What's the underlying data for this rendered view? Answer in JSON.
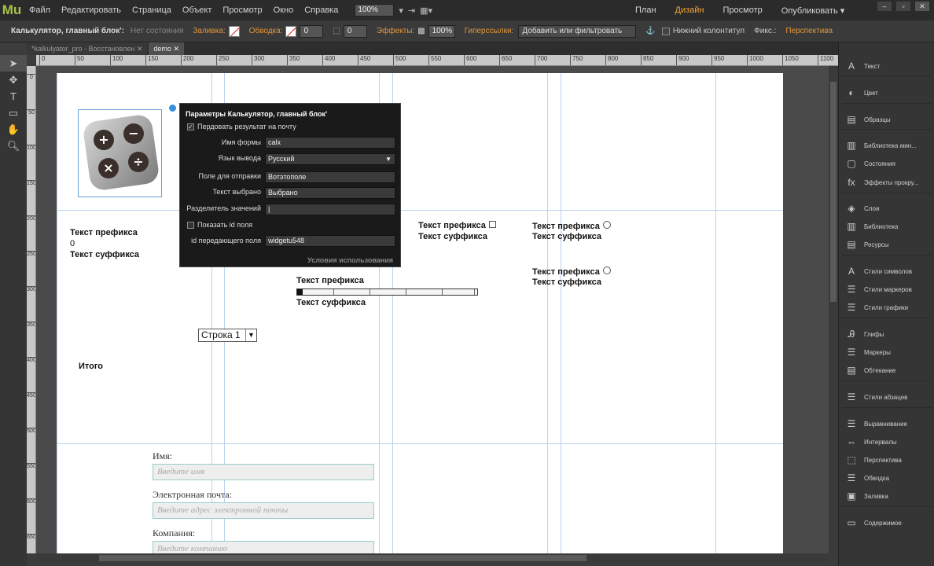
{
  "menubar": {
    "logo": "Mu",
    "items": [
      "Файл",
      "Редактировать",
      "Страница",
      "Объект",
      "Просмотр",
      "Окно",
      "Справка"
    ],
    "zoom": "100%",
    "modes": [
      "План",
      "Дизайн",
      "Просмотр",
      "Опубликовать ▾"
    ],
    "active_mode": "Дизайн"
  },
  "controlbar": {
    "title": "Калькулятор, главный блок':",
    "state": "Нет состояния",
    "fill_label": "Заливка:",
    "stroke_label": "Обводка:",
    "stroke_value": "0",
    "spacing_value": "0",
    "effects_label": "Эффекты:",
    "opacity": "100%",
    "hyperlinks_label": "Гиперссылки:",
    "hyperlink_placeholder": "Добавить или фильтровать",
    "footer_label": "Нижний колонтитул",
    "fix_label": "Фикс.:",
    "perspective_label": "Перспектива"
  },
  "tabs": [
    {
      "label": "*kalkulyator_pro - Восстановлен",
      "active": false
    },
    {
      "label": "demo",
      "active": true
    }
  ],
  "ruler_h": [
    "0",
    "50",
    "100",
    "150",
    "200",
    "250",
    "300",
    "350",
    "400",
    "450",
    "500",
    "550",
    "600",
    "650",
    "700",
    "750",
    "800",
    "850",
    "900",
    "950",
    "1000",
    "1050",
    "1100",
    "1150"
  ],
  "ruler_v": [
    "0",
    "50",
    "100",
    "150",
    "200",
    "250",
    "300",
    "350",
    "400",
    "450",
    "500",
    "550",
    "600",
    "650"
  ],
  "tools": [
    "selection-tool",
    "crop-tool",
    "text-tool",
    "rectangle-tool",
    "hand-tool",
    "zoom-tool"
  ],
  "page": {
    "block1_prefix": "Текст префикса",
    "block1_value": "0",
    "block1_suffix": "Текст суффикса",
    "block2_prefix": "Текст префикса",
    "block2_suffix": "Текст суффикса",
    "block3_prefix": "Текст префикса",
    "block3_suffix": "Текст суффикса",
    "block4_prefix": "Текст префикса",
    "block4_suffix": "Текст суффикса",
    "slider_prefix": "Текст префикса",
    "slider_suffix": "Текст суффикса",
    "select_value": "Строка 1",
    "total_label": "Итого",
    "form_name_label": "Имя:",
    "form_name_placeholder": "Введите имя",
    "form_email_label": "Электронная почта:",
    "form_email_placeholder": "Введите адрес электронной почты",
    "form_company_label": "Компания:",
    "form_company_placeholder": "Введите компанию"
  },
  "popup": {
    "title": "Параметры Калькулятор, главный блок'",
    "send_email_label": "Пердовать результат на почту",
    "form_name_label": "Имя формы",
    "form_name_value": "calx",
    "lang_label": "Язык вывода",
    "lang_value": "Русский",
    "send_field_label": "Поле для отправки",
    "send_field_value": "Вотэтополе",
    "selected_text_label": "Текст выбрано",
    "selected_text_value": "Выбрано",
    "separator_label": "Разделитель значений",
    "separator_value": "|",
    "show_id_label": "Показать id поля",
    "field_id_label": "id передающего поля",
    "field_id_value": "widgetu548",
    "footer": "Условия использования"
  },
  "rpanel": [
    "Текст",
    "Цвет",
    "Образцы",
    "Библиотека мин...",
    "Состояния",
    "Эффекты прокру...",
    "Слои",
    "Библиотека",
    "Ресурсы",
    "Стили символов",
    "Стили маркеров",
    "Стили графики",
    "Глифы",
    "Маркеры",
    "Обтекание",
    "Стили абзацев",
    "Выравнивание",
    "Интервалы",
    "Перспектива",
    "Обводка",
    "Заливка",
    "Содержимое"
  ],
  "colors": {
    "accent": "#f2a23a",
    "logo": "#a6c24a",
    "guide": "#b9d3ec"
  }
}
